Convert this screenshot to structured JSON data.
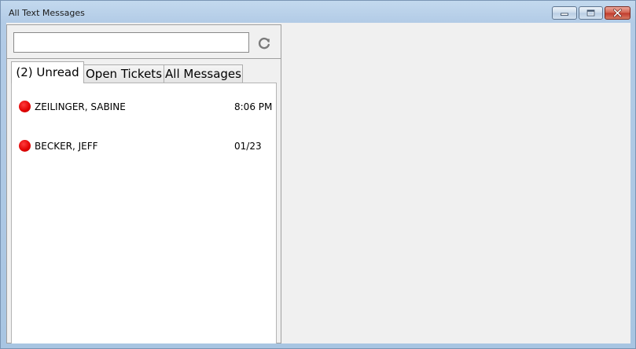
{
  "window": {
    "title": "All Text Messages"
  },
  "search": {
    "value": "",
    "placeholder": ""
  },
  "icons": {
    "refresh": "refresh-icon",
    "minimize": "minimize-icon",
    "maximize": "maximize-icon",
    "close": "close-icon",
    "unread": "unread-dot-icon"
  },
  "tabs": [
    {
      "label": "(2) Unread",
      "active": true
    },
    {
      "label": "Open Tickets",
      "active": false
    },
    {
      "label": "All Messages",
      "active": false
    }
  ],
  "messages": [
    {
      "name": "ZEILINGER, SABINE",
      "time": "8:06 PM",
      "status": "unread"
    },
    {
      "name": "BECKER, JEFF",
      "time": "01/23",
      "status": "unread"
    }
  ],
  "colors": {
    "unread_dot": "#e00000",
    "close_button": "#c0392b"
  }
}
